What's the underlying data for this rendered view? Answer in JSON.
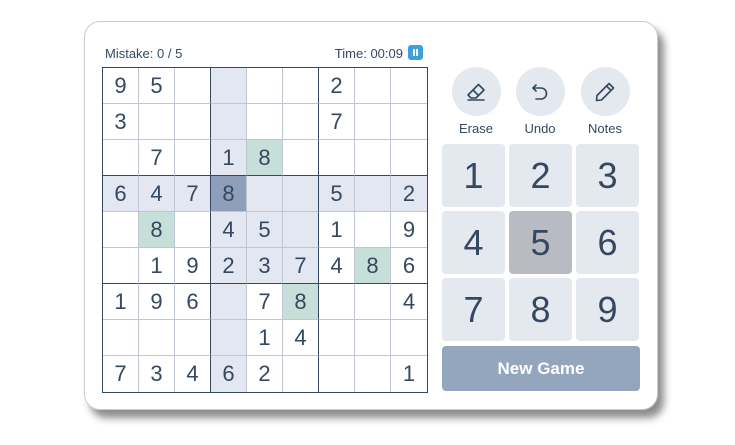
{
  "status": {
    "mistake_label": "Mistake:",
    "mistake_value": "0 / 5",
    "time_label": "Time:",
    "time_value": "00:09"
  },
  "board": {
    "rows": [
      [
        "9",
        "5",
        "",
        "",
        "",
        "",
        "2",
        "",
        ""
      ],
      [
        "3",
        "",
        "",
        "",
        "",
        "",
        "7",
        "",
        ""
      ],
      [
        "",
        "7",
        "",
        "1",
        "8",
        "",
        "",
        "",
        ""
      ],
      [
        "6",
        "4",
        "7",
        "8",
        "",
        "",
        "5",
        "",
        "2"
      ],
      [
        "",
        "8",
        "",
        "4",
        "5",
        "",
        "1",
        "",
        "9"
      ],
      [
        "",
        "1",
        "9",
        "2",
        "3",
        "7",
        "4",
        "8",
        "6"
      ],
      [
        "1",
        "9",
        "6",
        "",
        "7",
        "8",
        "",
        "",
        "4"
      ],
      [
        "",
        "",
        "",
        "",
        "1",
        "4",
        "",
        "",
        ""
      ],
      [
        "7",
        "3",
        "4",
        "6",
        "2",
        "",
        "",
        "",
        "1"
      ]
    ],
    "selected": {
      "row": 3,
      "col": 3
    },
    "colors": {
      "highlight": "#e2e7f1",
      "same_number": "#c6dfd9",
      "selected": "#8d9fbb",
      "grid": "#344861"
    }
  },
  "tools": {
    "erase": "Erase",
    "undo": "Undo",
    "notes": "Notes"
  },
  "numpad": {
    "keys": [
      "1",
      "2",
      "3",
      "4",
      "5",
      "6",
      "7",
      "8",
      "9"
    ],
    "active": "5"
  },
  "new_game_label": "New Game"
}
